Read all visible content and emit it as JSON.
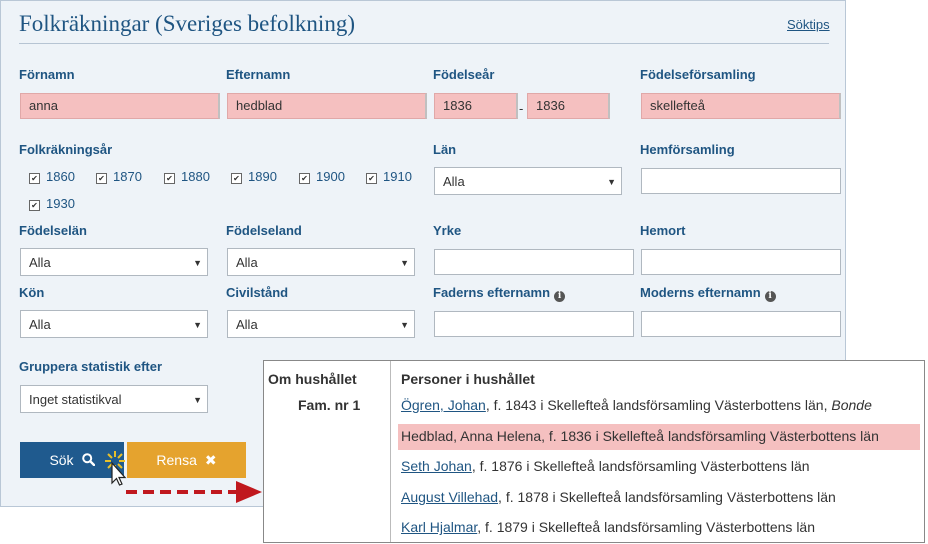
{
  "header": {
    "title": "Folkräkningar (Sveriges befolkning)",
    "link": "Söktips"
  },
  "fields": {
    "fornamn": {
      "label": "Förnamn",
      "value": "anna"
    },
    "efternamn": {
      "label": "Efternamn",
      "value": "hedblad"
    },
    "fodelsear": {
      "label": "Födelseår",
      "from": "1836",
      "to": "1836",
      "sep": "-"
    },
    "fodelseforsamling": {
      "label": "Födelseförsamling",
      "value": "skellefteå"
    },
    "folkrakningsar": {
      "label": "Folkräkningsår",
      "years": [
        "1860",
        "1870",
        "1880",
        "1890",
        "1900",
        "1910",
        "1930"
      ]
    },
    "lan": {
      "label": "Län",
      "value": "Alla"
    },
    "hemforsamling": {
      "label": "Hemförsamling",
      "value": ""
    },
    "fodelselan": {
      "label": "Födelselän",
      "value": "Alla"
    },
    "fodelseland": {
      "label": "Födelseland",
      "value": "Alla"
    },
    "yrke": {
      "label": "Yrke",
      "value": ""
    },
    "hemort": {
      "label": "Hemort",
      "value": ""
    },
    "kon": {
      "label": "Kön",
      "value": "Alla"
    },
    "civilstand": {
      "label": "Civilstånd",
      "value": "Alla"
    },
    "faderns": {
      "label": "Faderns efternamn",
      "value": ""
    },
    "moderns": {
      "label": "Moderns efternamn",
      "value": ""
    },
    "gruppera": {
      "label": "Gruppera statistik efter",
      "value": "Inget statistikval"
    }
  },
  "buttons": {
    "search": "Sök",
    "clear": "Rensa"
  },
  "household": {
    "about_label": "Om hushållet",
    "persons_label": "Personer i hushållet",
    "family": "Fam. nr 1",
    "persons": [
      {
        "name": "Ögren, Johan",
        "details": ", f. 1843 i Skellefteå landsförsamling Västerbottens län, ",
        "role": "Bonde"
      },
      {
        "name": "Hedblad, Anna Helena",
        "details": ", f. 1836 i Skellefteå landsförsamling Västerbottens län",
        "role": ""
      },
      {
        "name": "Seth Johan",
        "details": ", f. 1876 i Skellefteå landsförsamling Västerbottens län",
        "role": ""
      },
      {
        "name": "August Villehad",
        "details": ", f. 1878 i Skellefteå landsförsamling Västerbottens län",
        "role": ""
      },
      {
        "name": "Karl Hjalmar",
        "details": ", f. 1879 i Skellefteå landsförsamling Västerbottens län",
        "role": ""
      }
    ]
  },
  "colors": {
    "brand_blue": "#1f5582",
    "search_button": "#1f5a8e",
    "clear_button": "#e5a32e",
    "highlight": "#f5c0c0",
    "arrow": "#c0181e"
  },
  "icons": {
    "search": "search-icon",
    "clear": "close-icon",
    "info": "info-icon",
    "cursor": "mouse-cursor-icon"
  }
}
